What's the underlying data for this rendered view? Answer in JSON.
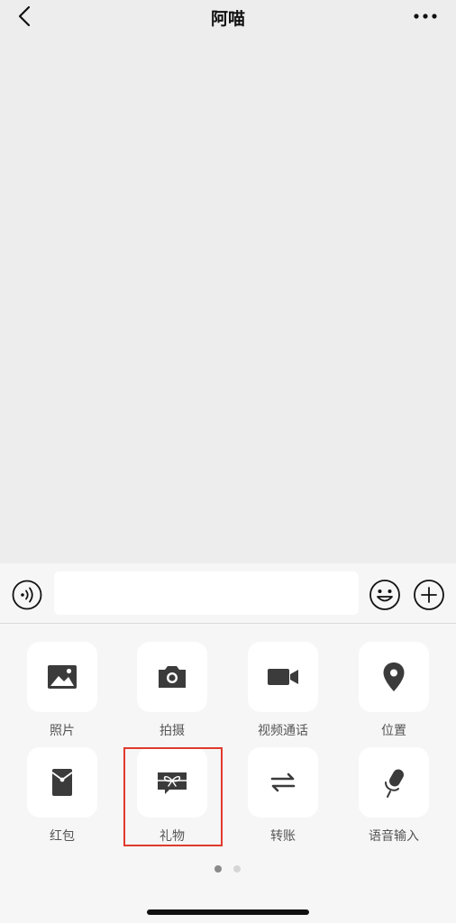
{
  "header": {
    "title": "阿喵"
  },
  "input": {
    "value": "",
    "placeholder": ""
  },
  "panel": {
    "items": [
      {
        "label": "照片",
        "icon": "photo-icon"
      },
      {
        "label": "拍摄",
        "icon": "camera-icon"
      },
      {
        "label": "视频通话",
        "icon": "video-call-icon"
      },
      {
        "label": "位置",
        "icon": "location-icon"
      },
      {
        "label": "红包",
        "icon": "red-packet-icon"
      },
      {
        "label": "礼物",
        "icon": "gift-icon"
      },
      {
        "label": "转账",
        "icon": "transfer-icon"
      },
      {
        "label": "语音输入",
        "icon": "voice-input-icon"
      }
    ],
    "highlighted_item": "礼物",
    "page_indicator": {
      "pages": 2,
      "current": 1
    }
  },
  "colors": {
    "background": "#ededed",
    "panel": "#f6f6f6",
    "icon": "#3b3b3b",
    "highlight": "#e03a2e"
  }
}
